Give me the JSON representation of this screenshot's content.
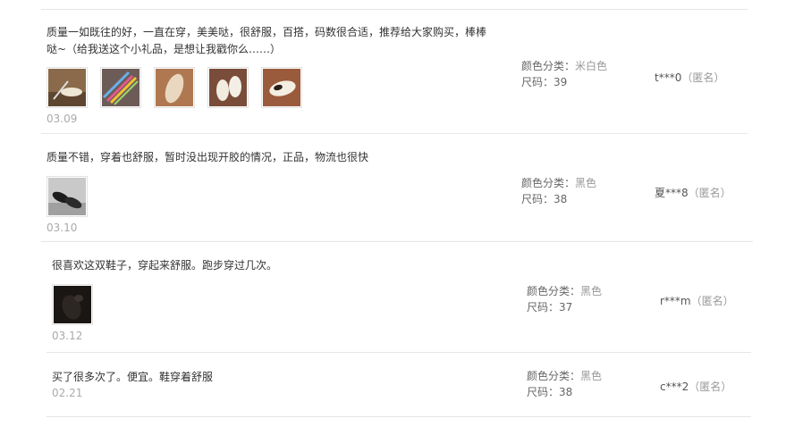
{
  "reviews": [
    {
      "text_line1": "质量一如既往的好，一直在穿，美美哒，很舒服，百搭，码数很合适，推荐给大家购买，棒棒",
      "text_line2": "哒~（给我送这个小礼品，是想让我戳你么……）",
      "date": "03.09",
      "color_label": "颜色分类：",
      "color_value": "米白色",
      "size_label": "尺码：",
      "size_value": "39",
      "user": "t***0",
      "anon": "（匿名）",
      "photos": [
        "shoe-photo-1",
        "pencils-photo",
        "insole-photo",
        "shoe-pair-photo",
        "shoe-top-photo"
      ]
    },
    {
      "text_line1": "质量不错，穿着也舒服，暂时没出现开胶的情况，正品，物流也很快",
      "date": "03.10",
      "color_label": "颜色分类：",
      "color_value": "黑色",
      "size_label": "尺码：",
      "size_value": "38",
      "user": "夏***8",
      "anon": "（匿名）",
      "photos": [
        "black-shoe-photo"
      ]
    },
    {
      "text_line1": "很喜欢这双鞋子，穿起来舒服。跑步穿过几次。",
      "date": "03.12",
      "color_label": "颜色分类：",
      "color_value": "黑色",
      "size_label": "尺码：",
      "size_value": "37",
      "user": "r***m",
      "anon": "（匿名）",
      "photos": [
        "dark-shoe-photo"
      ]
    },
    {
      "text_line1": "买了很多次了。便宜。鞋穿着舒服",
      "date": "02.21",
      "color_label": "颜色分类：",
      "color_value": "黑色",
      "size_label": "尺码：",
      "size_value": "38",
      "user": "c***2",
      "anon": "（匿名）"
    }
  ]
}
